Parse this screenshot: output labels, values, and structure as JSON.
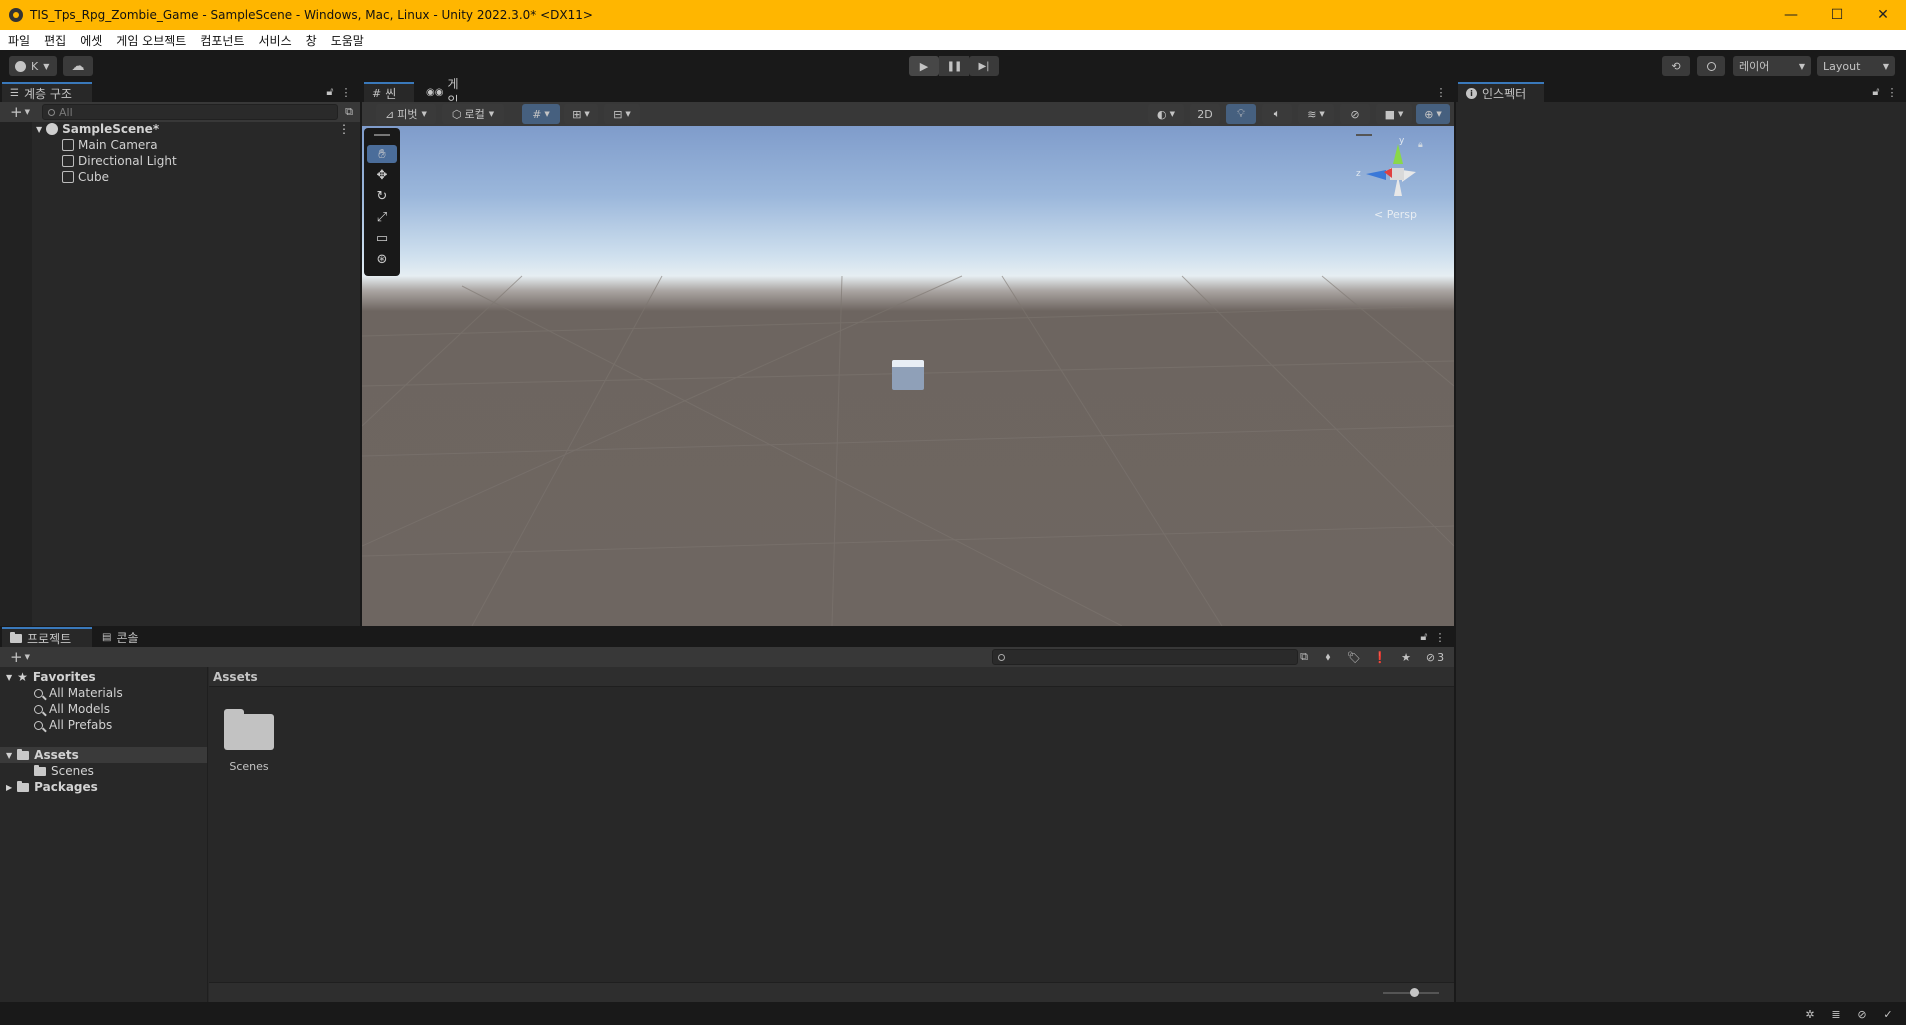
{
  "window": {
    "title": "TIS_Tps_Rpg_Zombie_Game - SampleScene - Windows, Mac, Linux - Unity 2022.3.0* <DX11>",
    "minimize": "—",
    "maximize": "☐",
    "close": "✕"
  },
  "menu": [
    "파일",
    "편집",
    "에셋",
    "게임 오브젝트",
    "컴포넌트",
    "서비스",
    "창",
    "도움말"
  ],
  "toolbar": {
    "account_label": "K",
    "layers_label": "레이어",
    "layout_label": "Layout"
  },
  "hierarchy": {
    "tab_label": "계층 구조",
    "search_placeholder": "All",
    "scene_name": "SampleScene*",
    "items": [
      "Main Camera",
      "Directional Light",
      "Cube"
    ]
  },
  "scene": {
    "tab_scene": "씬",
    "tab_game": "게임",
    "pivot_label": "피벗",
    "local_label": "로컬",
    "mode_2d": "2D",
    "persp_label": "< Persp",
    "gizmo_y": "y",
    "gizmo_z": "z"
  },
  "inspector": {
    "tab_label": "인스펙터"
  },
  "project": {
    "tab_project": "프로젝트",
    "tab_console": "콘솔",
    "favorites_label": "Favorites",
    "favorites": [
      "All Materials",
      "All Models",
      "All Prefabs"
    ],
    "assets_label": "Assets",
    "assets_children": [
      "Scenes"
    ],
    "packages_label": "Packages",
    "breadcrumb": "Assets",
    "grid_items": [
      "Scenes"
    ],
    "hidden_count": "3"
  },
  "colors": {
    "titlebar": "#ffb600",
    "accent": "#3a79bb",
    "panel": "#282828",
    "toolbar": "#191919"
  }
}
